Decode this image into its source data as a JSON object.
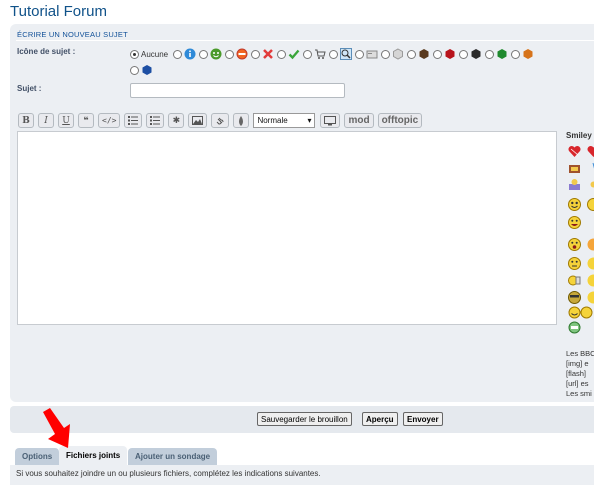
{
  "forum_title": "Tutorial Forum",
  "panel_header": "ÉCRIRE UN NOUVEAU SUJET",
  "topic_icon": {
    "label": "Icône de sujet :",
    "none_label": "Aucune",
    "icons": [
      "info-icon",
      "smile-icon",
      "forbidden-icon",
      "red-x-icon",
      "green-check-icon",
      "cart-icon",
      "magnifier-icon",
      "card-icon",
      "gray-cube-icon",
      "brown-cube-icon",
      "red-cube-icon",
      "black-cube-icon",
      "green-cube-icon",
      "orange-cube-icon",
      "blue-cube-icon"
    ]
  },
  "subject": {
    "label": "Sujet :",
    "value": ""
  },
  "toolbar": {
    "bold": "B",
    "italic": "I",
    "underline": "U",
    "font_size": "Normale",
    "mod": "mod",
    "offtopic": "offtopic"
  },
  "smilies": {
    "title": "Smiley"
  },
  "bbcode_info": [
    "Les BBC",
    "[img] e",
    "[flash]",
    "[url] es",
    "Les smi"
  ],
  "buttons": {
    "save_draft": "Sauvegarder le brouillon",
    "preview": "Aperçu",
    "submit": "Envoyer"
  },
  "tabs": [
    "Options",
    "Fichiers joints",
    "Ajouter un sondage"
  ],
  "attachments_text": "Si vous souhaitez joindre un ou plusieurs fichiers, complétez les indications suivantes.",
  "colors": {
    "title": "#105289",
    "panel": "#eceff3",
    "arrow": "#ff0000"
  }
}
